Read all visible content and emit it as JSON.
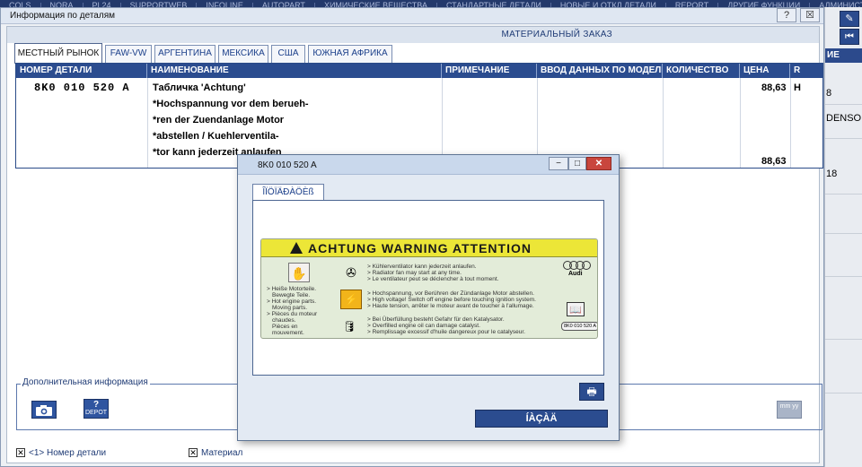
{
  "topbar": {
    "items": [
      "COLS",
      "NORA",
      "PL24",
      "SUPPORTWEB",
      "INFOLINE",
      "AUTOPART",
      "ХИМИЧЕСКИЕ ВЕЩЕСТВА",
      "СТАНДАРТНЫЕ ДЕТАЛИ",
      "НОВЫЕ И ОТКЛ.ДЕТАЛИ",
      "REPORT",
      "ДРУГИЕ ФУНКЦИИ",
      "АДМИНИСТРИР"
    ]
  },
  "main_window": {
    "title": "Информация по деталям",
    "help_label": "?",
    "close_label": "☒"
  },
  "order_header": "МАТЕРИАЛЬНЫЙ ЗАКАЗ",
  "tabs": [
    "МЕСТНЫЙ РЫНОК",
    "FAW-VW",
    "АРГЕНТИНА",
    "МЕКСИКА",
    "США",
    "ЮЖНАЯ АФРИКА"
  ],
  "table": {
    "columns": [
      "НОМЕР ДЕТАЛИ",
      "НАИМЕНОВАНИЕ",
      "ПРИМЕЧАНИЕ",
      "ВВОД ДАННЫХ ПО МОДЕЛИ",
      "КОЛИЧЕСТВО",
      "ЦЕНА",
      "R"
    ],
    "row": {
      "part_number": "8K0 010 520 A",
      "name_lines": [
        "Табличка          'Achtung'",
        "*Hochspannung vor dem berueh-",
        "*ren der Zuendanlage Motor",
        "*abstellen / Kuehlerventila-",
        "*tor kann jederzeit anlaufen"
      ],
      "price": "88,63",
      "r": "H",
      "total_price": "88,63"
    }
  },
  "additional_info": {
    "legend": "Дополнительная информация",
    "depot_label": "DEPOT",
    "mmyy_label": "mm yy"
  },
  "bottom": {
    "part_number_label": "<1> Номер детали",
    "material_label": "Материал"
  },
  "right_strip": {
    "header": "ИЕ",
    "fragments": [
      "8",
      "DENSO",
      "18"
    ]
  },
  "dialog": {
    "title": "8K0 010 520 A",
    "tab_label": "ÎÏÖÏÄÐÀÖÈß",
    "ok_label": "ÍÀÇÀÄ",
    "label_image": {
      "heading": "ACHTUNG  WARNING  ATTENTION",
      "left_text": [
        "> Heiße Motorteile.",
        "Bewegte Teile.",
        "> Hot engine parts.",
        "Moving parts.",
        "> Pièces du moteur",
        "chaudes.",
        "Pièces en",
        "mouvement."
      ],
      "fan_text": [
        "> Kühlerventilator kann jederzeit anlaufen.",
        "> Radiator fan may start at any time.",
        "> Le ventilateur peut se déclencher à tout moment."
      ],
      "voltage_text": [
        "> Hochspannung, vor Berühren der Zündanlage Motor abstellen.",
        "> High voltage! Switch off engine before touching ignition system.",
        "> Haute tension, arrêter le moteur avant de toucher à l'allumage."
      ],
      "oil_text": [
        "> Bei Überfüllung besteht Gefahr für den Katalysator.",
        "> Overfilled engine oil can damage catalyst.",
        "> Remplissage excessif d'huile dangereux pour le catalyseur."
      ],
      "brand": "Audi",
      "part_code": "8K0 010 520 A"
    }
  }
}
